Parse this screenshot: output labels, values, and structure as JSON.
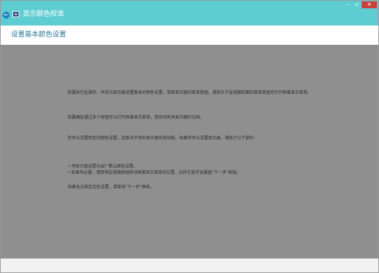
{
  "window": {
    "title": "显示颜色校准",
    "back_icon": "back-arrow-icon",
    "app_icon": "monitor-icon",
    "controls": {
      "minimize": "–",
      "maximize": "▫",
      "close": "✕"
    },
    "accent_color": "#5ecdd1",
    "close_color": "#c7413a"
  },
  "header": {
    "title": "设置基本颜色设置"
  },
  "content": {
    "paragraphs": [
      "若要执行此操作，并且为显示器设置基本的颜色设置，请按显示器的菜单按钮。通常位于监视器前面的菜单按钮可打开屏幕显示菜单。",
      "若要确定通过多个按钮可以打开屏幕显示菜单，请参阅有关显示器的文档。",
      "你可以设置特定的颜色设置，这取决于你的显示器及其功能。如果你可以设置显示器，请执行以下操作:"
    ],
    "bullets": [
      "• 将显示器设置为出厂默认颜色设置。",
      "• 如果有必要，请使用监视器按钮移动屏幕显示菜单的位置，这样它就不会覆盖\"下一步\"按钮。"
    ],
    "closing": "如果无法指定这些设置，请单击\"下一步\"继续。"
  }
}
